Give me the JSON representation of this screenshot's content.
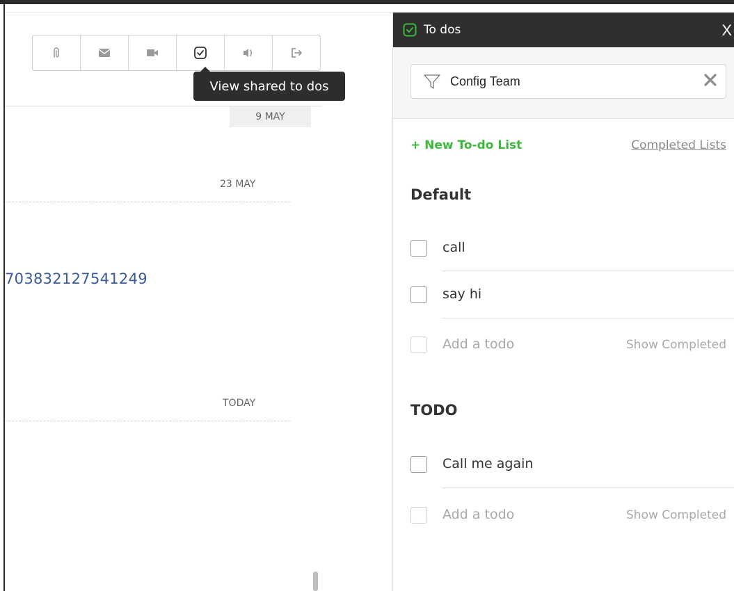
{
  "toolbar": {
    "tooltip": "View shared to dos"
  },
  "timeline": {
    "badge_date": "9 MAY",
    "date_2": "23 MAY",
    "number_text": "703832127541249",
    "date_3": "TODAY"
  },
  "panel": {
    "title": "To dos",
    "close": "X",
    "filter_value": "Config Team",
    "new_list": "+ New To-do List",
    "completed_lists": "Completed Lists",
    "sections": [
      {
        "title": "Default",
        "items": [
          "call",
          "say hi"
        ],
        "add_placeholder": "Add a todo",
        "show_completed": "Show Completed"
      },
      {
        "title": "TODO",
        "items": [
          "Call me again"
        ],
        "add_placeholder": "Add a todo",
        "show_completed": "Show Completed"
      }
    ]
  },
  "colors": {
    "accent_green": "#3db83d",
    "header_dark": "#2f2f2f",
    "link_blue": "#3a5b96"
  }
}
